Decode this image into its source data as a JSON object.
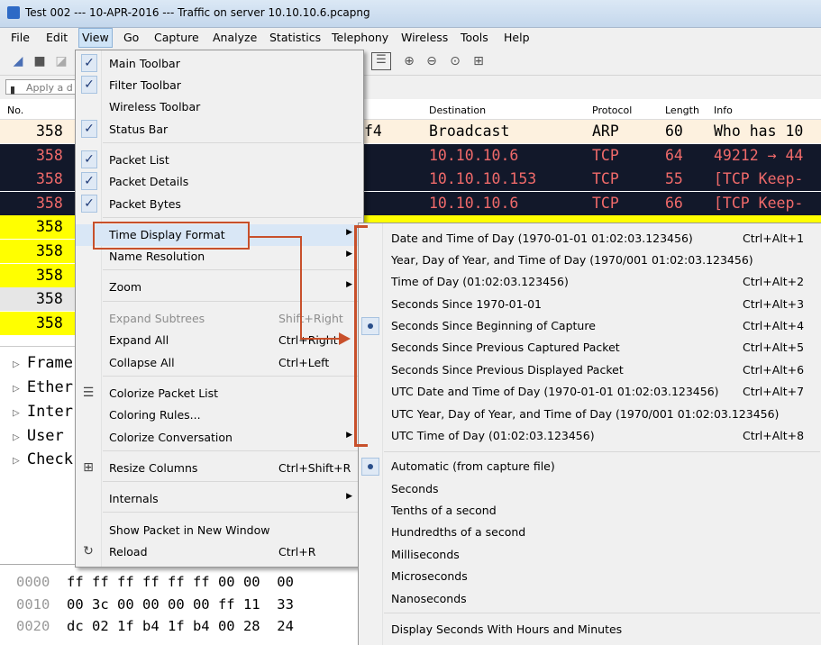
{
  "window": {
    "title": "Test 002 --- 10-APR-2016 --- Traffic on server 10.10.10.6.pcapng"
  },
  "menubar": [
    "File",
    "Edit",
    "View",
    "Go",
    "Capture",
    "Analyze",
    "Statistics",
    "Telephony",
    "Wireless",
    "Tools",
    "Help"
  ],
  "filter": {
    "placeholder": "Apply a d"
  },
  "packet_list": {
    "columns": [
      "No.",
      "Destination",
      "Protocol",
      "Length",
      "Info"
    ],
    "rows": [
      {
        "no": "358",
        "src_tail": "f4",
        "destination": "Broadcast",
        "protocol": "ARP",
        "length": "60",
        "info": "Who has 10",
        "bg": "#fdf1df",
        "fg": "#000000"
      },
      {
        "no": "358",
        "src_tail": "",
        "destination": "10.10.10.6",
        "protocol": "TCP",
        "length": "64",
        "info": "49212 → 44",
        "bg": "#12182a",
        "fg": "#f06a6a"
      },
      {
        "no": "358",
        "src_tail": "",
        "destination": "10.10.10.153",
        "protocol": "TCP",
        "length": "55",
        "info": "[TCP Keep-",
        "bg": "#12182a",
        "fg": "#f06a6a"
      },
      {
        "no": "358",
        "src_tail": "",
        "destination": "10.10.10.6",
        "protocol": "TCP",
        "length": "66",
        "info": "[TCP Keep-",
        "bg": "#12182a",
        "fg": "#f06a6a"
      },
      {
        "no": "358",
        "bg": "#ffff00",
        "fg": "#000000"
      },
      {
        "no": "358",
        "bg": "#ffff00",
        "fg": "#000000"
      },
      {
        "no": "358",
        "bg": "#ffff00",
        "fg": "#000000"
      },
      {
        "no": "358",
        "bg": "#e6e6e6",
        "fg": "#000000"
      },
      {
        "no": "358",
        "bg": "#ffff00",
        "fg": "#000000"
      }
    ]
  },
  "details": [
    "Frame",
    "Ether",
    "Inter",
    "User",
    "Check"
  ],
  "bytes": [
    {
      "off": "0000",
      "hex": "ff ff ff ff ff ff 00 00  00"
    },
    {
      "off": "0010",
      "hex": "00 3c 00 00 00 00 ff 11  33"
    },
    {
      "off": "0020",
      "hex": "dc 02 1f b4 1f b4 00 28  24"
    }
  ],
  "view_menu": {
    "items": [
      {
        "label": "Main Toolbar",
        "checked": true
      },
      {
        "label": "Filter Toolbar",
        "checked": true
      },
      {
        "label": "Wireless Toolbar",
        "checked": false
      },
      {
        "label": "Status Bar",
        "checked": true
      },
      {
        "label": "Packet List",
        "checked": true
      },
      {
        "label": "Packet Details",
        "checked": true
      },
      {
        "label": "Packet Bytes",
        "checked": true
      },
      {
        "label": "Time Display Format",
        "submenu": true,
        "highlighted": true
      },
      {
        "label": "Name Resolution",
        "submenu": true
      },
      {
        "label": "Zoom",
        "submenu": true
      },
      {
        "label": "Expand Subtrees",
        "shortcut": "Shift+Right",
        "disabled": true
      },
      {
        "label": "Expand All",
        "shortcut": "Ctrl+Right"
      },
      {
        "label": "Collapse All",
        "shortcut": "Ctrl+Left"
      },
      {
        "label": "Colorize Packet List",
        "icon": "list-icon"
      },
      {
        "label": "Coloring Rules..."
      },
      {
        "label": "Colorize Conversation",
        "submenu": true
      },
      {
        "label": "Resize Columns",
        "shortcut": "Ctrl+Shift+R",
        "icon": "resize-columns-icon"
      },
      {
        "label": "Internals",
        "submenu": true
      },
      {
        "label": "Show Packet in New Window"
      },
      {
        "label": "Reload",
        "shortcut": "Ctrl+R",
        "icon": "reload-icon"
      }
    ]
  },
  "time_format_menu": {
    "items": [
      {
        "label": "Date and Time of Day (1970-01-01 01:02:03.123456)",
        "shortcut": "Ctrl+Alt+1"
      },
      {
        "label": "Year, Day of Year, and Time of Day (1970/001 01:02:03.123456)",
        "shortcut": ""
      },
      {
        "label": "Time of Day (01:02:03.123456)",
        "shortcut": "Ctrl+Alt+2"
      },
      {
        "label": "Seconds Since 1970-01-01",
        "shortcut": "Ctrl+Alt+3"
      },
      {
        "label": "Seconds Since Beginning of Capture",
        "shortcut": "Ctrl+Alt+4",
        "selected": true
      },
      {
        "label": "Seconds Since Previous Captured Packet",
        "shortcut": "Ctrl+Alt+5"
      },
      {
        "label": "Seconds Since Previous Displayed Packet",
        "shortcut": "Ctrl+Alt+6"
      },
      {
        "label": "UTC Date and Time of Day (1970-01-01 01:02:03.123456)",
        "shortcut": "Ctrl+Alt+7"
      },
      {
        "label": "UTC Year, Day of Year, and Time of Day (1970/001 01:02:03.123456)",
        "shortcut": ""
      },
      {
        "label": "UTC Time of Day (01:02:03.123456)",
        "shortcut": "Ctrl+Alt+8"
      }
    ],
    "precision": [
      {
        "label": "Automatic (from capture file)",
        "selected": true
      },
      {
        "label": "Seconds"
      },
      {
        "label": "Tenths of a second"
      },
      {
        "label": "Hundredths of a second"
      },
      {
        "label": "Milliseconds"
      },
      {
        "label": "Microseconds"
      },
      {
        "label": "Nanoseconds"
      }
    ],
    "extra": "Display Seconds With Hours and Minutes"
  },
  "colors": {
    "annotation": "#c8502b",
    "menu_bg": "#f0f0f0"
  }
}
